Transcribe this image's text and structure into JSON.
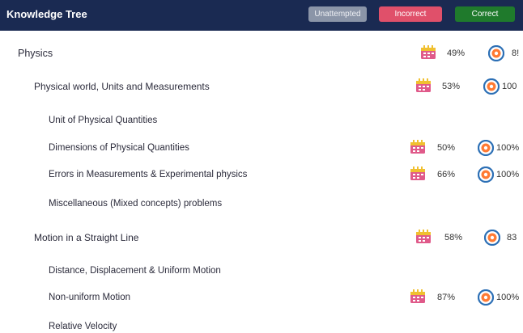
{
  "header": {
    "title": "Knowledge Tree",
    "legend": {
      "unattempted": "Unattempted",
      "incorrect": "Incorrect",
      "correct": "Correct"
    }
  },
  "colors": {
    "header_bg": "#1a2a52",
    "unattempted": "#8b95a8",
    "incorrect": "#e0506a",
    "correct": "#1f7a2c",
    "calendar_icon": "#e05a8a",
    "target_ring": "#2c6fb5",
    "target_center": "#ff7a33"
  },
  "tree": [
    {
      "label": "Physics",
      "level": 0,
      "attempted": "49%",
      "accuracy": "8!"
    },
    {
      "label": "Physical world, Units and Measurements",
      "level": 1,
      "attempted": "53%",
      "accuracy": "100"
    },
    {
      "label": "Unit of Physical Quantities",
      "level": 2
    },
    {
      "label": "Dimensions of Physical Quantities",
      "level": 2,
      "attempted": "50%",
      "accuracy": "100%"
    },
    {
      "label": "Errors in Measurements & Experimental physics",
      "level": 2,
      "attempted": "66%",
      "accuracy": "100%"
    },
    {
      "label": "Miscellaneous (Mixed concepts) problems",
      "level": 2
    },
    {
      "label": "Motion in a Straight Line",
      "level": 1,
      "attempted": "58%",
      "accuracy": "83"
    },
    {
      "label": "Distance, Displacement & Uniform Motion",
      "level": 2
    },
    {
      "label": "Non-uniform Motion",
      "level": 2,
      "attempted": "87%",
      "accuracy": "100%"
    },
    {
      "label": "Relative Velocity",
      "level": 2
    }
  ]
}
